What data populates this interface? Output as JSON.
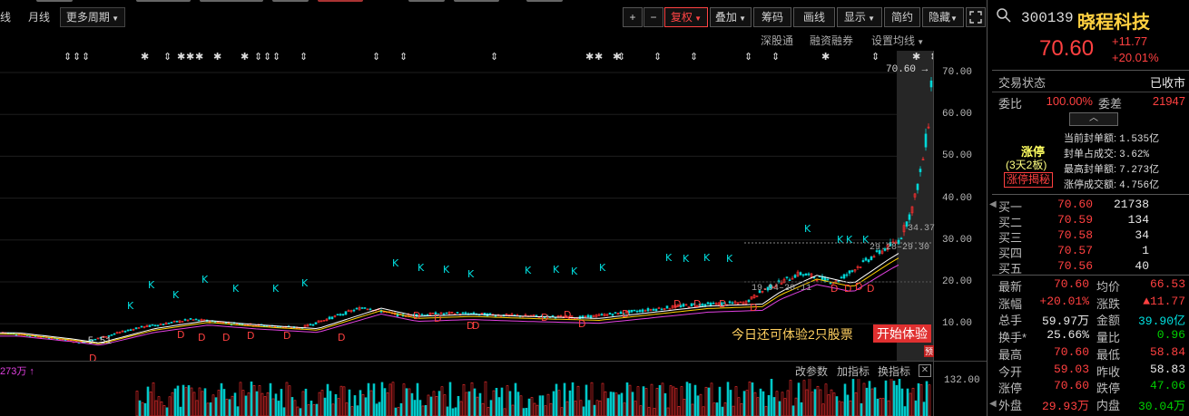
{
  "toolbar": {
    "tabs": [
      "线",
      "月线",
      "更多周期"
    ],
    "plus": "+",
    "minus": "−",
    "fuquan": "复权",
    "overlay": "叠加",
    "chips": "筹码",
    "draw": "画线",
    "display": "显示",
    "simple": "简约",
    "hide": "隐藏",
    "expand_icon": "expand-icon"
  },
  "subbar": {
    "shenguntong": "深股通",
    "margin": "融资融券",
    "ma_settings": "设置均线"
  },
  "chart": {
    "y_ticks": [
      "70.00",
      "60.00",
      "50.00",
      "40.00",
      "30.00",
      "20.00",
      "10.00"
    ],
    "price_tag": "70.60",
    "low_mark": "5.51",
    "label_a": "29.28",
    "label_b": "29.30",
    "label_c": "34.37",
    "label_d1": "19.94",
    "label_d2": "20.11",
    "promo_text": "今日还可体验2只股票",
    "promo_button": "开始体验",
    "yu_tag": "预"
  },
  "volume": {
    "vol_text": "273万",
    "change_param": "改参数",
    "add_indicator": "加指标",
    "switch_indicator": "换指标",
    "scale_top": "132.00"
  },
  "quote": {
    "code": "300139",
    "name": "晓程科技",
    "price": "70.60",
    "change": "+11.77",
    "change_pct": "+20.01%",
    "status_label": "交易状态",
    "status_value": "已收市",
    "weibi_label": "委比",
    "weibi_value": "100.00%",
    "weicha_label": "委差",
    "weicha_value": "21947",
    "limit_title": "涨停",
    "limit_days": "(3天2板)",
    "limit_secret": "涨停揭秘",
    "seal_amount_label": "当前封单额:",
    "seal_amount": "1.535亿",
    "seal_ratio_label": "封单占成交:",
    "seal_ratio": "3.62%",
    "max_seal_label": "最高封单额:",
    "max_seal": "7.273亿",
    "limit_turnover_label": "涨停成交额:",
    "limit_turnover": "4.756亿"
  },
  "orderbook": [
    {
      "label": "买一",
      "price": "70.60",
      "vol": "21738"
    },
    {
      "label": "买二",
      "price": "70.59",
      "vol": "134"
    },
    {
      "label": "买三",
      "price": "70.58",
      "vol": "34"
    },
    {
      "label": "买四",
      "price": "70.57",
      "vol": "1"
    },
    {
      "label": "买五",
      "price": "70.56",
      "vol": "40"
    }
  ],
  "stats": [
    {
      "l1": "最新",
      "v1": "70.60",
      "c1": "red",
      "l2": "均价",
      "v2": "66.53",
      "c2": "red"
    },
    {
      "l1": "涨幅",
      "v1": "+20.01%",
      "c1": "red",
      "l2": "涨跌",
      "v2": "▲11.77",
      "c2": "red"
    },
    {
      "l1": "总手",
      "v1": "59.97万",
      "c1": "white",
      "l2": "金额",
      "v2": "39.90亿",
      "c2": "cyan"
    },
    {
      "l1": "换手*",
      "v1": "25.66%",
      "c1": "white",
      "l2": "量比",
      "v2": "0.96",
      "c2": "green"
    },
    {
      "l1": "最高",
      "v1": "70.60",
      "c1": "red",
      "l2": "最低",
      "v2": "58.84",
      "c2": "red"
    },
    {
      "l1": "今开",
      "v1": "59.03",
      "c1": "red",
      "l2": "昨收",
      "v2": "58.83",
      "c2": "white"
    },
    {
      "l1": "涨停",
      "v1": "70.60",
      "c1": "red",
      "l2": "跌停",
      "v2": "47.06",
      "c2": "green"
    },
    {
      "l1": "外盘",
      "v1": "29.93万",
      "c1": "red",
      "l2": "内盘",
      "v2": "30.04万",
      "c2": "green"
    }
  ]
}
